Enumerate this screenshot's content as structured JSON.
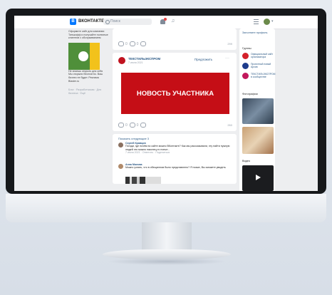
{
  "header": {
    "brand": "ВКОНТАКТЕ",
    "logo_letter": "B",
    "search_placeholder": "Поиск"
  },
  "left": {
    "text1": "Оформите сайт для компании Тинькофф и получайте полезные клиентов с обслуживанием",
    "text2": "Не знаешь открыть для себя",
    "text3": "Мы открыли бесплатно. Ваш бизнес не будет. Реклама Blaster.ru",
    "footer": "Блог · Разработчикам · Для бизнеса · Ещё"
  },
  "post": {
    "group_name": "ТЕКСТИЛЬЭКСПРОМ",
    "date": "7 июля 2021",
    "share_label": "Предложить",
    "more": "···",
    "banner_text": "НОВОСТЬ УЧАСТНИКА",
    "likes": "0",
    "comments_count": "0",
    "views": "260"
  },
  "top_card": {
    "likes": "0",
    "comments_count": "0",
    "views": "299"
  },
  "comments": {
    "show_previous": "Показать следующие 3",
    "c1_author": "Сергей Кравцов",
    "c1_text": "Погоди, где почём на сайте можно ВКонтакте? Как мы рассказывали, эту найти нужную людей это можно наконец-то попыт...",
    "c1_meta": "7 июля 2021 · Ответить · Поделиться",
    "c2_author": "Анна Малова",
    "c2_text": "Можно узнать, что в обещанном было представлено? Я позже, Вы сможете увидеть"
  },
  "right": {
    "title": "Заполните профиль",
    "groups_label": "Группы",
    "g1": "Официальный сайт организатора",
    "g2": "Проектный новый Архив",
    "g3": "ТЕКСТИЛЬЭКСПРОМ в сообществе",
    "photos_label": "Фотографии",
    "video_label": "Видео"
  },
  "colors": {
    "accent": "#0077ff",
    "banner_red": "#c50e16",
    "link": "#2a5885"
  }
}
